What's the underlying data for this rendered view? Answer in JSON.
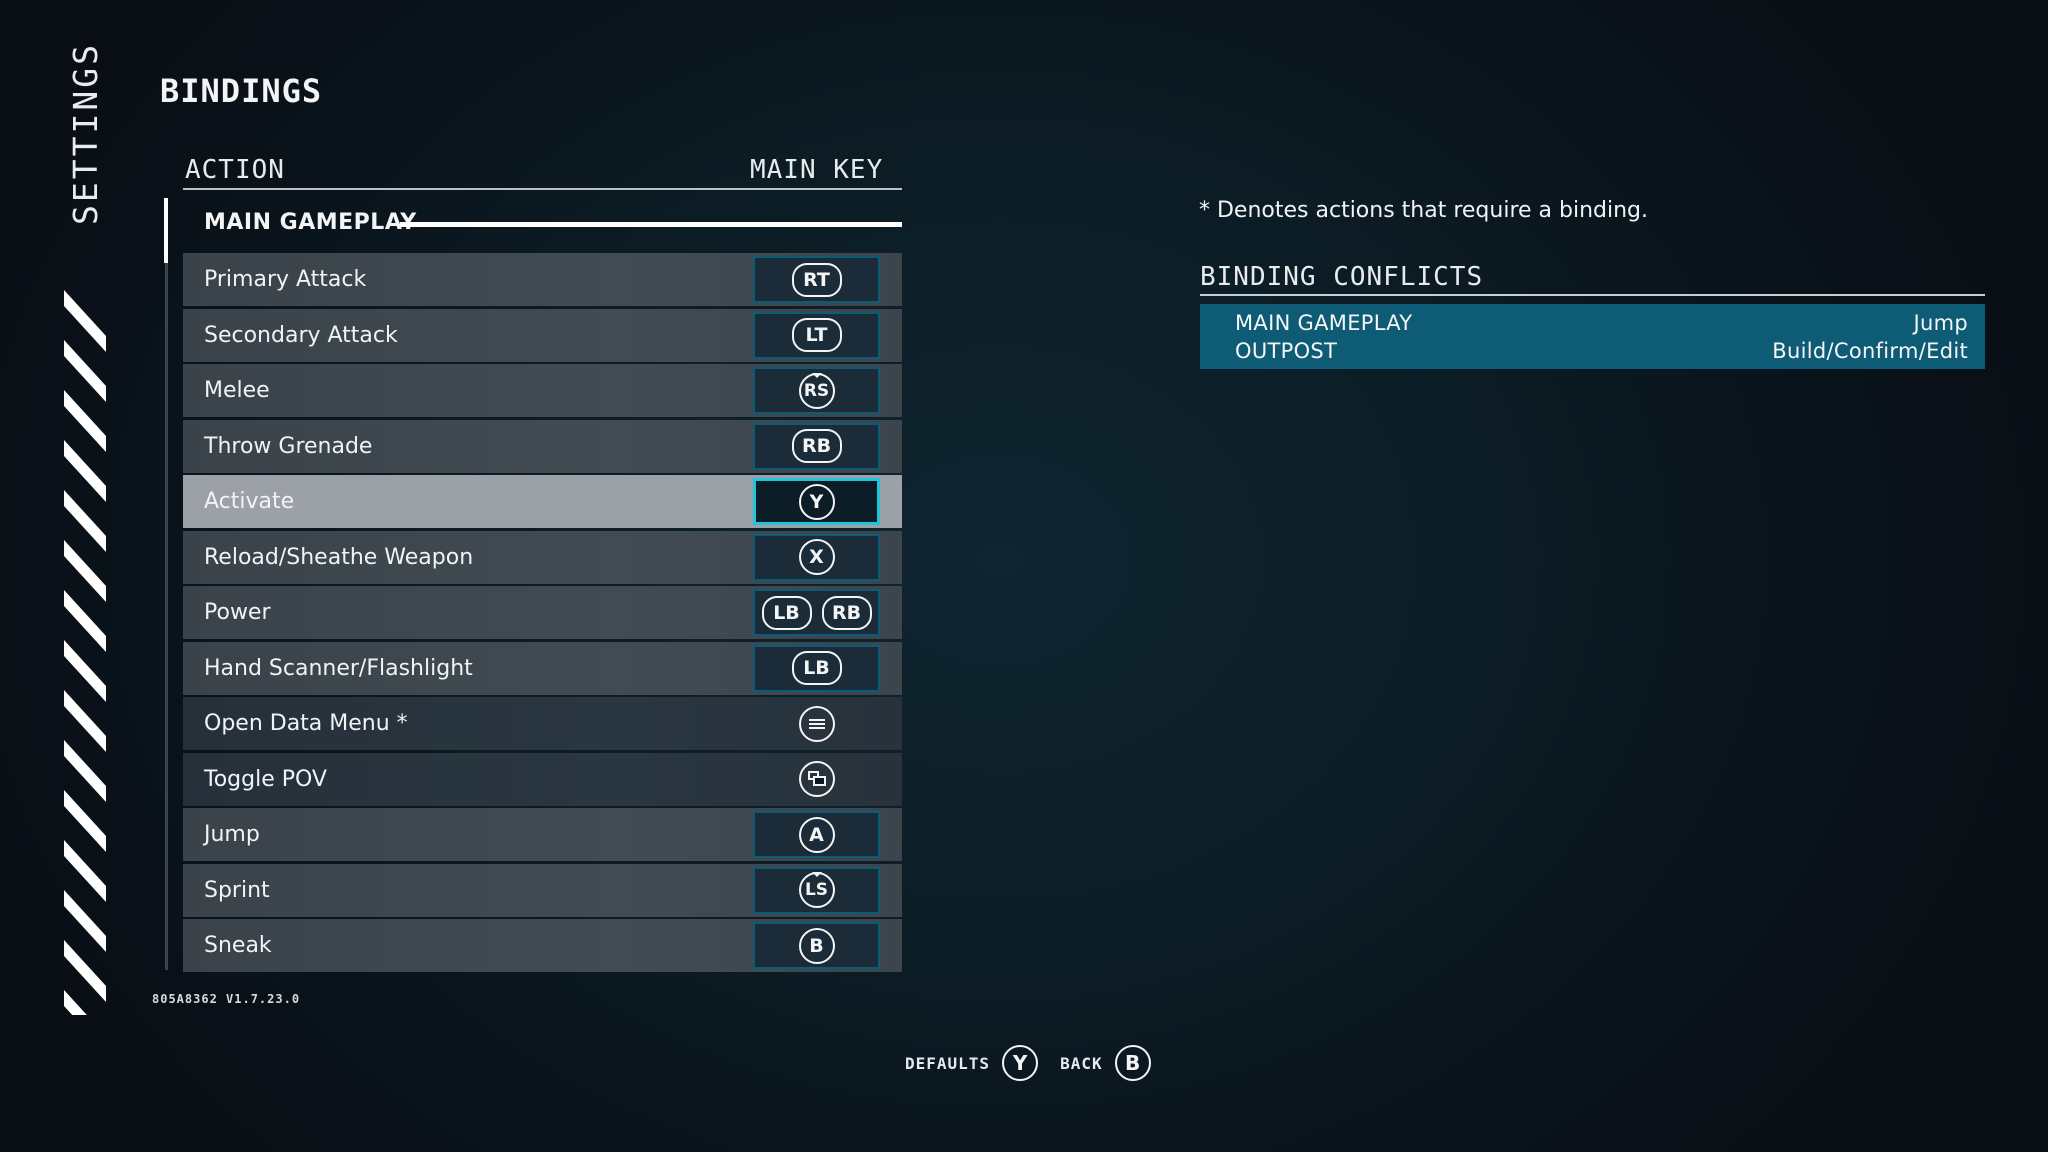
{
  "sidebar": {
    "label": "SETTINGS"
  },
  "page": {
    "title": "BINDINGS"
  },
  "table": {
    "columns": {
      "action": "ACTION",
      "main_key": "MAIN KEY"
    },
    "group": "MAIN GAMEPLAY",
    "rows": [
      {
        "action": "Primary Attack",
        "keys": [
          "RT"
        ],
        "style": "normal"
      },
      {
        "action": "Secondary Attack",
        "keys": [
          "LT"
        ],
        "style": "normal"
      },
      {
        "action": "Melee",
        "keys": [
          "RS"
        ],
        "style": "normal"
      },
      {
        "action": "Throw Grenade",
        "keys": [
          "RB"
        ],
        "style": "normal"
      },
      {
        "action": "Activate",
        "keys": [
          "Y"
        ],
        "style": "selected"
      },
      {
        "action": "Reload/Sheathe Weapon",
        "keys": [
          "X"
        ],
        "style": "normal"
      },
      {
        "action": "Power",
        "keys": [
          "LB",
          "RB"
        ],
        "style": "normal"
      },
      {
        "action": "Hand Scanner/Flashlight",
        "keys": [
          "LB"
        ],
        "style": "normal"
      },
      {
        "action": "Open Data Menu *",
        "keys": [
          "menu-icon"
        ],
        "style": "locked"
      },
      {
        "action": "Toggle POV",
        "keys": [
          "view-icon"
        ],
        "style": "locked"
      },
      {
        "action": "Jump",
        "keys": [
          "A"
        ],
        "style": "normal"
      },
      {
        "action": "Sprint",
        "keys": [
          "LS"
        ],
        "style": "normal"
      },
      {
        "action": "Sneak",
        "keys": [
          "B"
        ],
        "style": "normal"
      }
    ]
  },
  "version": "805A8362 V1.7.23.0",
  "info": {
    "note": "* Denotes actions that require a binding.",
    "conflicts_title": "BINDING CONFLICTS",
    "conflicts": [
      {
        "category": "MAIN GAMEPLAY",
        "action": "Jump"
      },
      {
        "category": "OUTPOST",
        "action": "Build/Confirm/Edit"
      }
    ]
  },
  "footer": {
    "defaults_label": "DEFAULTS",
    "defaults_button": "Y",
    "back_label": "BACK",
    "back_button": "B"
  },
  "colors": {
    "accent_cyan": "#21c5da",
    "conflict_bg": "#0e5b76",
    "key_border": "#0d5b76"
  }
}
